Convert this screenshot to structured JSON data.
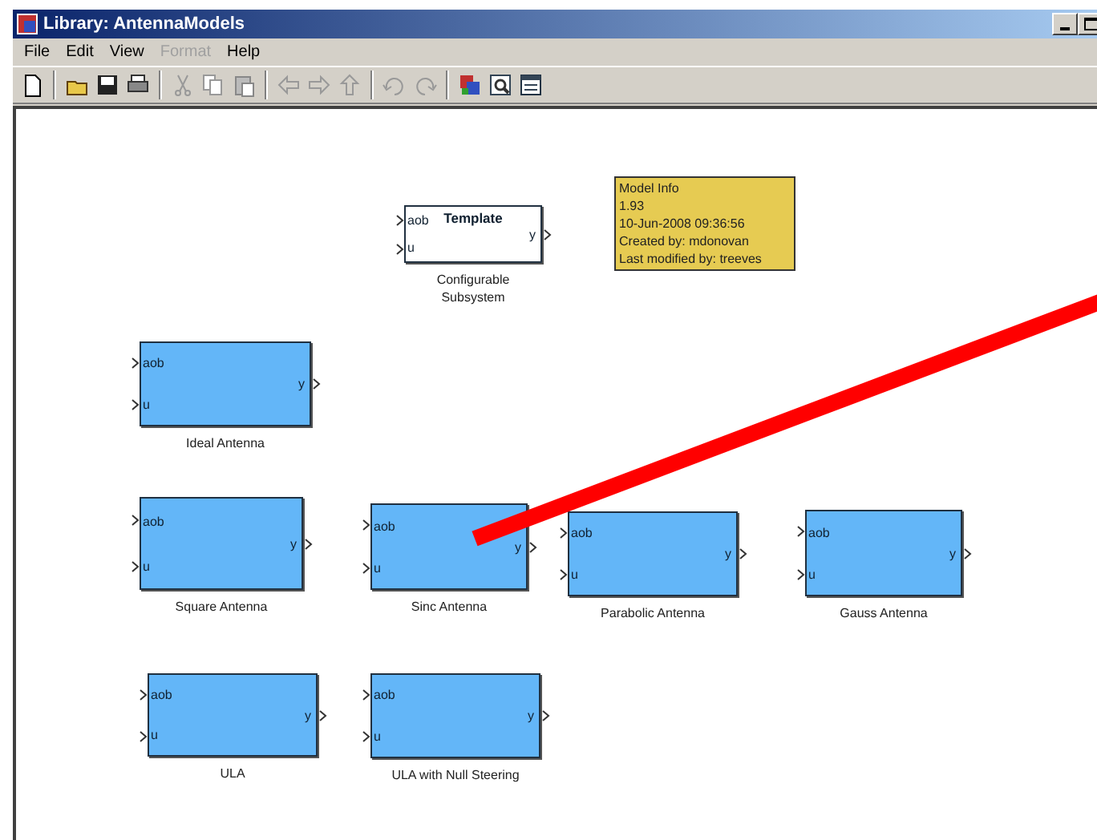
{
  "window": {
    "title": "Library: AntennaModels"
  },
  "menu": [
    {
      "label": "File",
      "disabled": false
    },
    {
      "label": "Edit",
      "disabled": false
    },
    {
      "label": "View",
      "disabled": false
    },
    {
      "label": "Format",
      "disabled": true
    },
    {
      "label": "Help",
      "disabled": false
    }
  ],
  "model_info": {
    "lines": [
      "Model Info",
      "1.93",
      "10-Jun-2008 09:36:56",
      "Created by: mdonovan",
      "Last modified by: treeves"
    ]
  },
  "blocks": [
    {
      "kind": "template",
      "title": "Template",
      "inputs": [
        "aob",
        "u"
      ],
      "output": "y",
      "caption": "Configurable Subsystem"
    },
    {
      "kind": "filled",
      "inputs": [
        "aob",
        "u"
      ],
      "output": "y",
      "caption": "Ideal Antenna"
    },
    {
      "kind": "filled",
      "inputs": [
        "aob",
        "u"
      ],
      "output": "y",
      "caption": "Square Antenna"
    },
    {
      "kind": "filled",
      "inputs": [
        "aob",
        "u"
      ],
      "output": "y",
      "caption": "Sinc Antenna"
    },
    {
      "kind": "filled",
      "inputs": [
        "aob",
        "u"
      ],
      "output": "y",
      "caption": "Parabolic Antenna"
    },
    {
      "kind": "filled",
      "inputs": [
        "aob",
        "u"
      ],
      "output": "y",
      "caption": "Gauss Antenna"
    },
    {
      "kind": "filled",
      "inputs": [
        "aob",
        "u"
      ],
      "output": "y",
      "caption": "ULA"
    },
    {
      "kind": "filled",
      "inputs": [
        "aob",
        "u"
      ],
      "output": "y",
      "caption": "ULA with Null Steering"
    }
  ]
}
